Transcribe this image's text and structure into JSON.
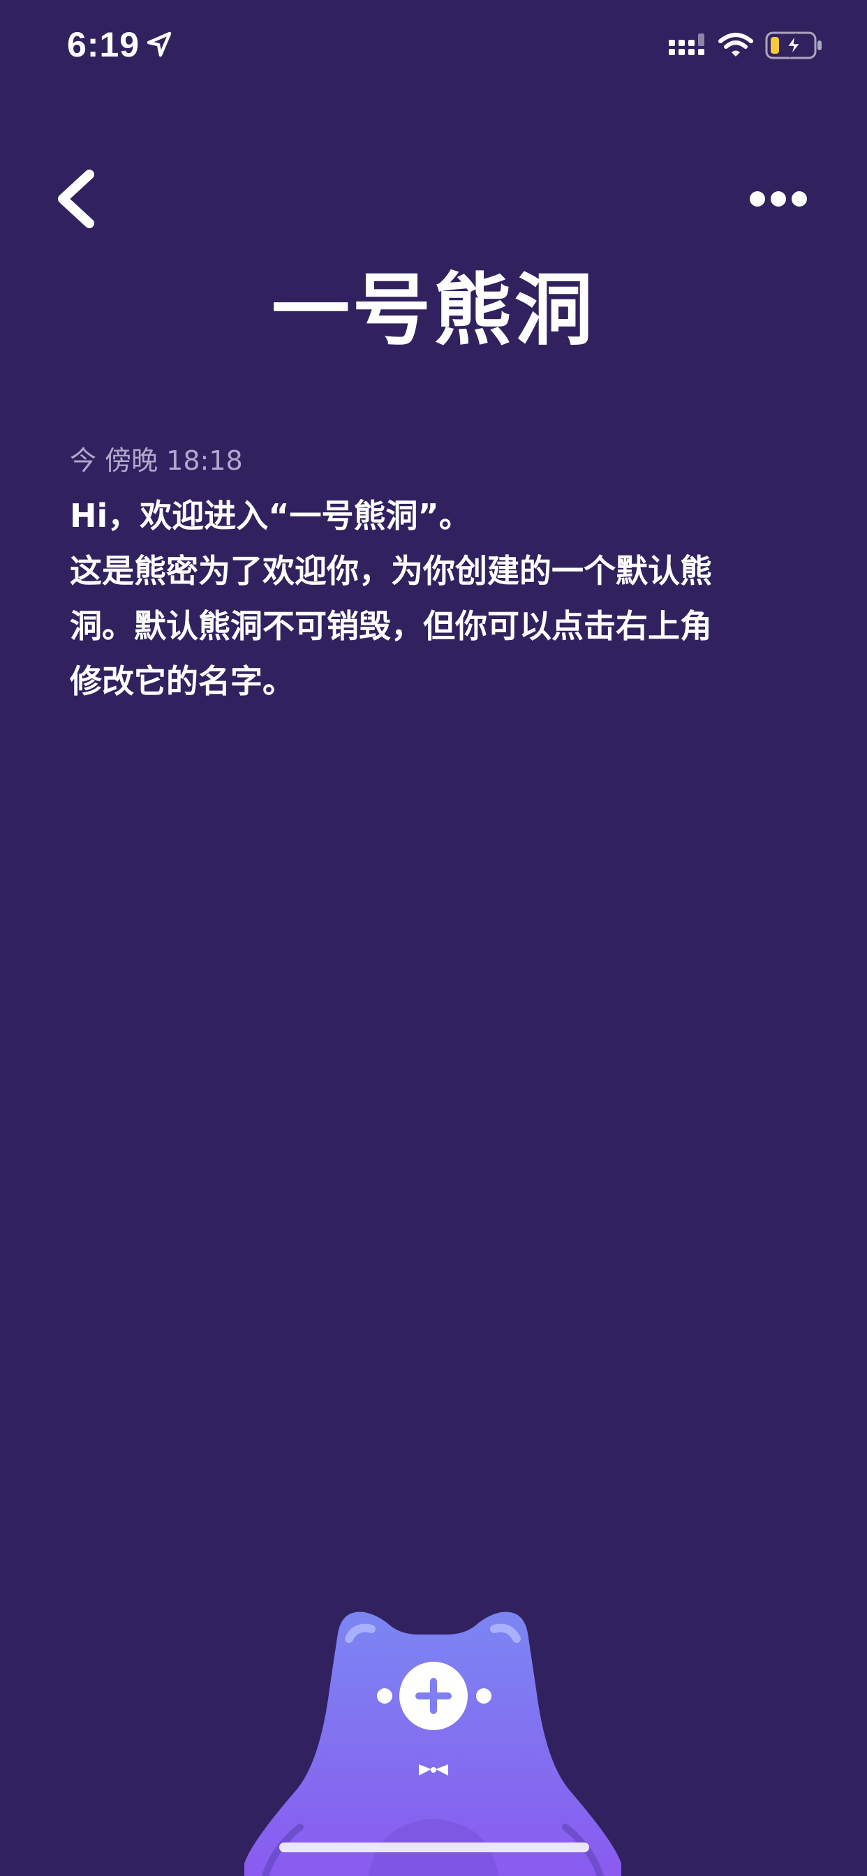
{
  "status_bar": {
    "time": "6:19",
    "icons": [
      "location-arrow-icon",
      "cellular-signal-icon",
      "wifi-icon",
      "battery-charging-icon"
    ]
  },
  "nav": {
    "back_icon": "chevron-left-icon",
    "more_icon": "ellipsis-icon"
  },
  "page": {
    "title": "一号熊洞"
  },
  "message": {
    "timestamp": "今 傍晚 18:18",
    "lines": [
      "Hi，欢迎进入“一号熊洞”。",
      "这是熊密为了欢迎你，为你创建的一个默认熊",
      "洞。默认熊洞不可销毁，但你可以点击右上角",
      "修改它的名字。"
    ]
  },
  "bottom": {
    "add_button_icon": "bear-add-icon"
  },
  "colors": {
    "background": "#31225f",
    "timestamp": "#b1a7cf",
    "bear_gradient_top": "#7b86f2",
    "bear_gradient_bottom": "#8a5bef",
    "battery_charge": "#f5c93a"
  }
}
